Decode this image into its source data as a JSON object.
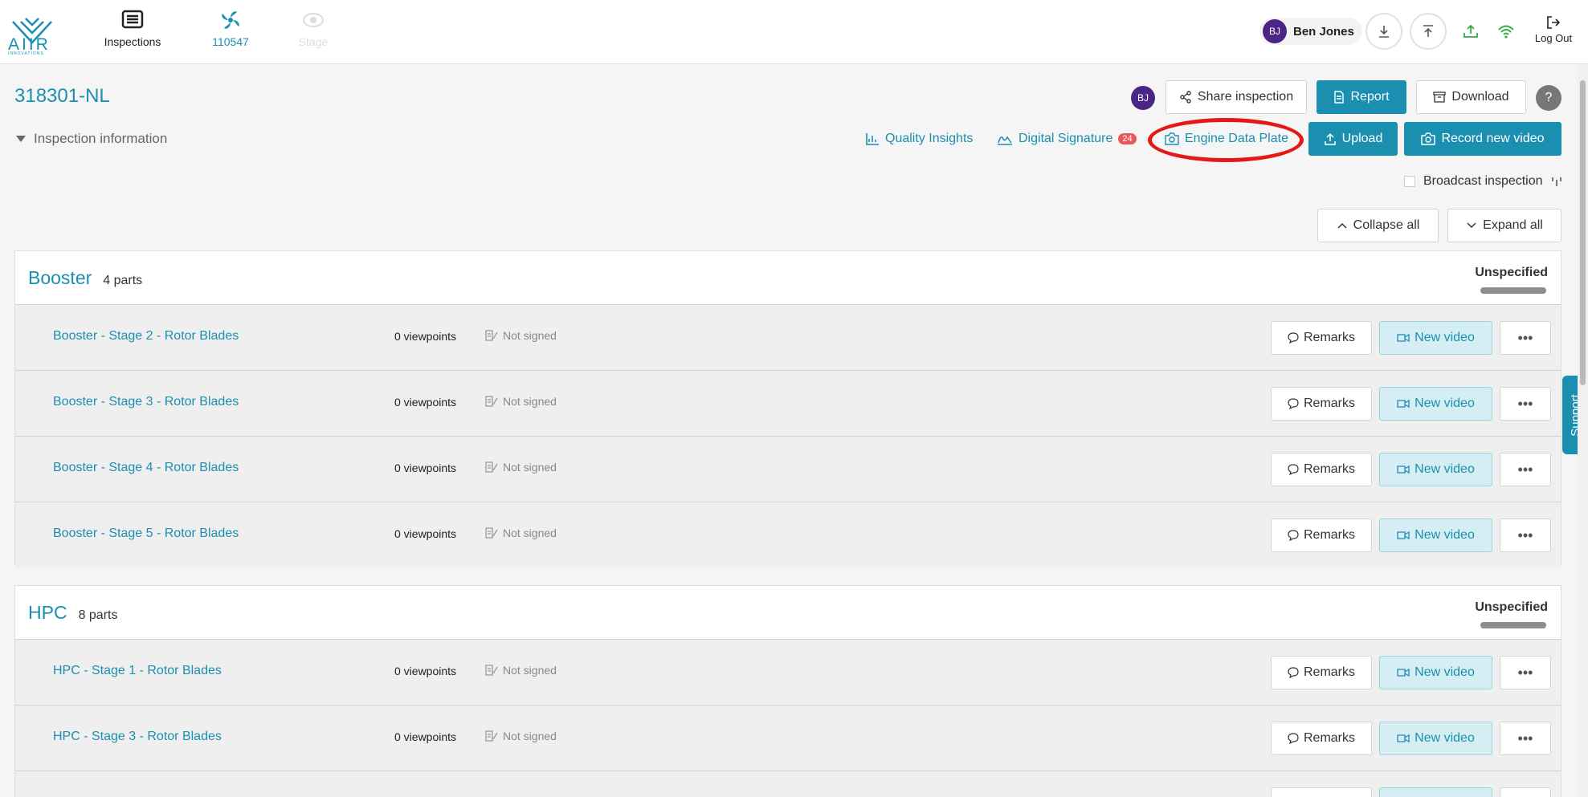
{
  "brand": {
    "logo_text": "AIIR",
    "logo_sub": "INNOVATIONS",
    "accent": "#1a8fb0"
  },
  "nav": [
    {
      "label": "Inspections",
      "icon": "list-icon"
    },
    {
      "label": "110547",
      "icon": "fan-icon"
    },
    {
      "label": "Stage",
      "icon": "eye-icon"
    }
  ],
  "user": {
    "initials": "BJ",
    "name": "Ben Jones"
  },
  "logout_label": "Log Out",
  "inspection": {
    "title": "318301-NL",
    "info_label": "Inspection information",
    "share_label": "Share inspection",
    "report_label": "Report",
    "download_label": "Download",
    "help": "?",
    "quality_label": "Quality Insights",
    "signature_label": "Digital Signature",
    "signature_count": "24",
    "engine_plate_label": "Engine Data Plate",
    "upload_label": "Upload",
    "record_label": "Record new video",
    "broadcast_label": "Broadcast inspection",
    "collapse_label": "Collapse all",
    "expand_label": "Expand all"
  },
  "row_labels": {
    "remarks": "Remarks",
    "new_video": "New video",
    "more": "•••"
  },
  "sections": [
    {
      "name": "Booster",
      "count": "4 parts",
      "status": "Unspecified",
      "rows": [
        {
          "title": "Booster - Stage 2 - Rotor Blades",
          "viewpoints": "0 viewpoints",
          "signed": "Not signed"
        },
        {
          "title": "Booster - Stage 3 - Rotor Blades",
          "viewpoints": "0 viewpoints",
          "signed": "Not signed"
        },
        {
          "title": "Booster - Stage 4 - Rotor Blades",
          "viewpoints": "0 viewpoints",
          "signed": "Not signed"
        },
        {
          "title": "Booster - Stage 5 - Rotor Blades",
          "viewpoints": "0 viewpoints",
          "signed": "Not signed"
        }
      ]
    },
    {
      "name": "HPC",
      "count": "8 parts",
      "status": "Unspecified",
      "rows": [
        {
          "title": "HPC - Stage 1 - Rotor Blades",
          "viewpoints": "0 viewpoints",
          "signed": "Not signed"
        },
        {
          "title": "HPC - Stage 3 - Rotor Blades",
          "viewpoints": "0 viewpoints",
          "signed": "Not signed"
        },
        {
          "title": "",
          "viewpoints": "",
          "signed": ""
        }
      ]
    }
  ],
  "support_label": "Support"
}
